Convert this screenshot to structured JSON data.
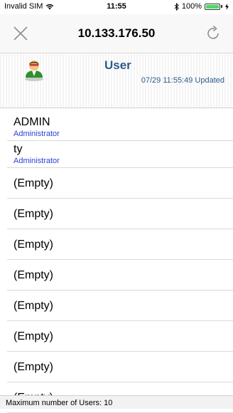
{
  "status_bar": {
    "carrier": "Invalid SIM",
    "time": "11:55",
    "battery_percent": "100%",
    "battery_level": 1.0
  },
  "nav": {
    "title": "10.133.176.50",
    "close_icon": "close-icon",
    "refresh_icon": "refresh-icon"
  },
  "header": {
    "title": "User",
    "updated": "07/29 11:55:49 Updated"
  },
  "users": [
    {
      "name": "ADMIN",
      "role": "Administrator"
    },
    {
      "name": "ty",
      "role": "Administrator"
    }
  ],
  "empty_slots": [
    "(Empty)",
    "(Empty)",
    "(Empty)",
    "(Empty)",
    "(Empty)",
    "(Empty)",
    "(Empty)",
    "(Empty)"
  ],
  "footer": {
    "text": "Maximum number of Users:  10"
  },
  "colors": {
    "accent": "#2c5c8a",
    "role_text": "#2a41d8",
    "battery": "#4cd964"
  }
}
